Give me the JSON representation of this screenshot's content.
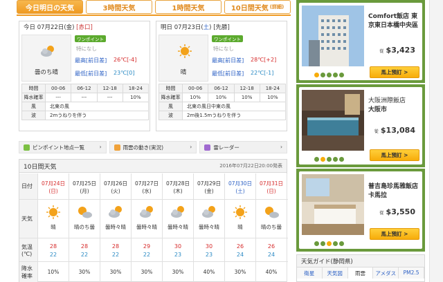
{
  "tabs": [
    {
      "label": "今日明日の天気",
      "small": ""
    },
    {
      "label": "3時間天気",
      "small": ""
    },
    {
      "label": "1時間天気",
      "small": ""
    },
    {
      "label": "10日間天気",
      "small": "(詳細)"
    }
  ],
  "today": {
    "date": "今日 07月22日(金)",
    "rokuyo": "[赤口]",
    "weather": "曇のち晴",
    "onepoint_badge": "ワンポイント",
    "onepoint_text": "特になし",
    "high_label": "最高[前日差]",
    "high": "26℃[-4]",
    "low_label": "最低[前日差]",
    "low": "23℃[0]",
    "time_header": [
      "時間",
      "00-06",
      "06-12",
      "12-18",
      "18-24"
    ],
    "rain_label": "降水確率",
    "rain": [
      "---",
      "---",
      "---",
      "10%"
    ],
    "wind_label": "風",
    "wind": "北東の風",
    "wave_label": "波",
    "wave": "2mうねりを伴う"
  },
  "tomorrow": {
    "date_prefix": "明日 07月23日(",
    "weekday": "土",
    "date_suffix": ")",
    "rokuyo": "[先勝]",
    "weather": "晴",
    "onepoint_badge": "ワンポイント",
    "onepoint_text": "特になし",
    "high_label": "最高[前日差]",
    "high": "28℃[+2]",
    "low_label": "最低[前日差]",
    "low": "22℃[-1]",
    "time_header": [
      "時間",
      "00-06",
      "06-12",
      "12-18",
      "18-24"
    ],
    "rain_label": "降水確率",
    "rain": [
      "10%",
      "10%",
      "10%",
      "10%"
    ],
    "wind_label": "風",
    "wind": "北東の風日中東の風",
    "wave_label": "波",
    "wave": "2m後1.5mうねりを伴う"
  },
  "links": [
    "ピンポイント地点一覧",
    "雨雲の動き(実況)",
    "雷レーダー"
  ],
  "ten_day": {
    "title": "10日間天気",
    "published": "2016年07月22日20:00発表",
    "row_labels": {
      "date": "日付",
      "weather": "天気",
      "temp": "気温(℃)",
      "rain": "降水確率"
    },
    "days": [
      {
        "date": "07月24日",
        "wd": "(日)",
        "kind": "sun",
        "weather": "晴",
        "icon": "sun",
        "hi": "28",
        "lo": "22",
        "rain": "10%"
      },
      {
        "date": "07月25日",
        "wd": "(月)",
        "kind": "",
        "weather": "晴のち曇",
        "icon": "sun-cloud",
        "hi": "28",
        "lo": "22",
        "rain": "30%"
      },
      {
        "date": "07月26日",
        "wd": "(火)",
        "kind": "",
        "weather": "曇時々晴",
        "icon": "cloud-sun",
        "hi": "28",
        "lo": "22",
        "rain": "30%"
      },
      {
        "date": "07月27日",
        "wd": "(水)",
        "kind": "",
        "weather": "曇時々晴",
        "icon": "cloud-sun",
        "hi": "29",
        "lo": "22",
        "rain": "30%"
      },
      {
        "date": "07月28日",
        "wd": "(木)",
        "kind": "",
        "weather": "曇時々晴",
        "icon": "cloud-sun",
        "hi": "30",
        "lo": "23",
        "rain": "30%"
      },
      {
        "date": "07月29日",
        "wd": "(金)",
        "kind": "",
        "weather": "曇時々晴",
        "icon": "cloud-sun",
        "hi": "30",
        "lo": "23",
        "rain": "40%"
      },
      {
        "date": "07月30日",
        "wd": "(土)",
        "kind": "sat",
        "weather": "晴",
        "icon": "sun",
        "hi": "26",
        "lo": "24",
        "rain": "30%"
      },
      {
        "date": "07月31日",
        "wd": "(日)",
        "kind": "sun",
        "weather": "晴のち曇",
        "icon": "sun-cloud",
        "hi": "26",
        "lo": "24",
        "rain": "40%"
      }
    ]
  },
  "hotels": [
    {
      "name": "Comfort飯店 東京東日本橋中央區",
      "price_prefix": "從",
      "price": "$3,423",
      "button": "馬上預訂 >"
    },
    {
      "name": "大阪洲際飯店",
      "name2": "大阪市",
      "price_prefix": "從",
      "price": "$13,084",
      "button": "馬上預訂 >"
    },
    {
      "name": "普吉島珍馬雅飯店",
      "name2": "卡馬拉",
      "price_prefix": "從",
      "price": "$3,550",
      "button": "馬上預訂 >"
    }
  ],
  "guide": {
    "title": "天気ガイド(静岡県)",
    "tabs": [
      "衛星",
      "天気図",
      "雨雲",
      "アメダス",
      "PM2.5"
    ]
  },
  "colors": {
    "accent": "#ef9a22",
    "hotel_frame": "#6a9a3c",
    "high": "#d62a2a",
    "low": "#2a8ac4",
    "link": "#2a5fc4"
  }
}
